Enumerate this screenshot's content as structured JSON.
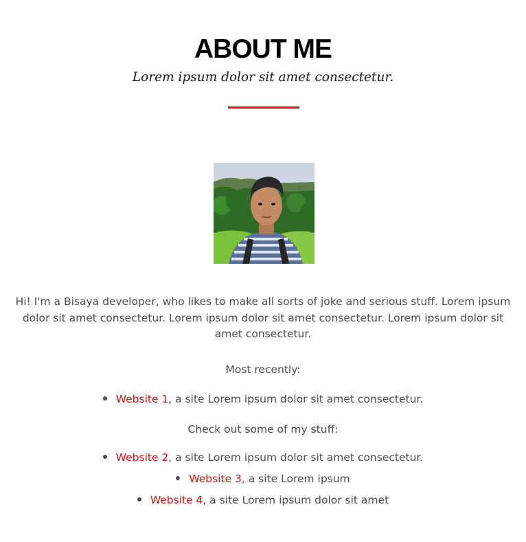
{
  "header": {
    "title": "ABOUT ME",
    "subtitle": "Lorem ipsum dolor sit amet consectetur."
  },
  "colors": {
    "accent": "#e01010",
    "text": "#4a4a4a",
    "heading": "#000000"
  },
  "bio": "Hi! I'm a Bisaya developer, who likes to make all sorts of joke and serious stuff. Lorem ipsum dolor sit amet consectetur. Lorem ipsum dolor sit amet consectetur. Lorem ipsum dolor sit amet consectetur.",
  "recent": {
    "label": "Most recently:",
    "items": [
      {
        "link": "Website 1",
        "desc": ", a site Lorem ipsum dolor sit amet consectetur."
      }
    ]
  },
  "stuff": {
    "label": "Check out some of my stuff:",
    "items": [
      {
        "link": "Website 2",
        "desc": ", a site Lorem ipsum dolor sit amet consectetur."
      },
      {
        "link": "Website 3",
        "desc": ", a site Lorem ipsum"
      },
      {
        "link": "Website 4",
        "desc": ", a site Lorem ipsum dolor sit amet"
      }
    ]
  }
}
